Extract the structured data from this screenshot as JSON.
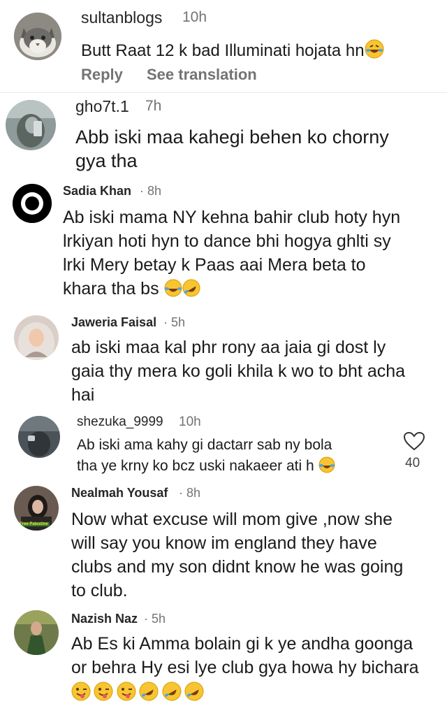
{
  "comments": [
    {
      "username": "sultanblogs",
      "time": "10h",
      "lines": [
        "Butt Raat 12 k bad Illuminati hojata hn"
      ],
      "reply_label": "Reply",
      "translate_label": "See translation"
    },
    {
      "username": "gho7t.1",
      "time": "7h",
      "lines": [
        "Abb iski maa kahegi behen ko chorny",
        "gya tha"
      ]
    },
    {
      "username": "Sadia Khan",
      "time": "· 8h",
      "lines": [
        "Ab iski mama NY kehna bahir club hoty hyn",
        "lrkiyan hoti hyn to dance bhi hogya ghlti sy",
        "lrki Mery betay k Paas aai Mera beta to",
        "khara tha bs"
      ]
    },
    {
      "username": "Jaweria Faisal",
      "time": "· 5h",
      "lines": [
        "ab iski maa kal phr rony aa jaia gi dost ly",
        "gaia thy mera ko goli khila k wo to bht acha",
        "hai"
      ]
    },
    {
      "username": "shezuka_9999",
      "time": "10h",
      "lines": [
        "Ab iski ama kahy gi dactarr sab ny bola",
        "tha ye krny ko bcz uski nakaeer ati h"
      ],
      "like_count": "40"
    },
    {
      "username": "Nealmah Yousaf",
      "time": "· 8h",
      "lines": [
        "Now what excuse will mom give ,now she",
        "will say you know im england they have",
        "clubs and my son didnt know he was going",
        "to club."
      ],
      "avatar_caption": "Free Palestine"
    },
    {
      "username": "Nazish Naz",
      "time": "· 5h",
      "lines": [
        "Ab Es ki Amma bolain gi k ye andha goonga",
        "or behra Hy esi lye club gya howa hy bichara"
      ]
    }
  ]
}
